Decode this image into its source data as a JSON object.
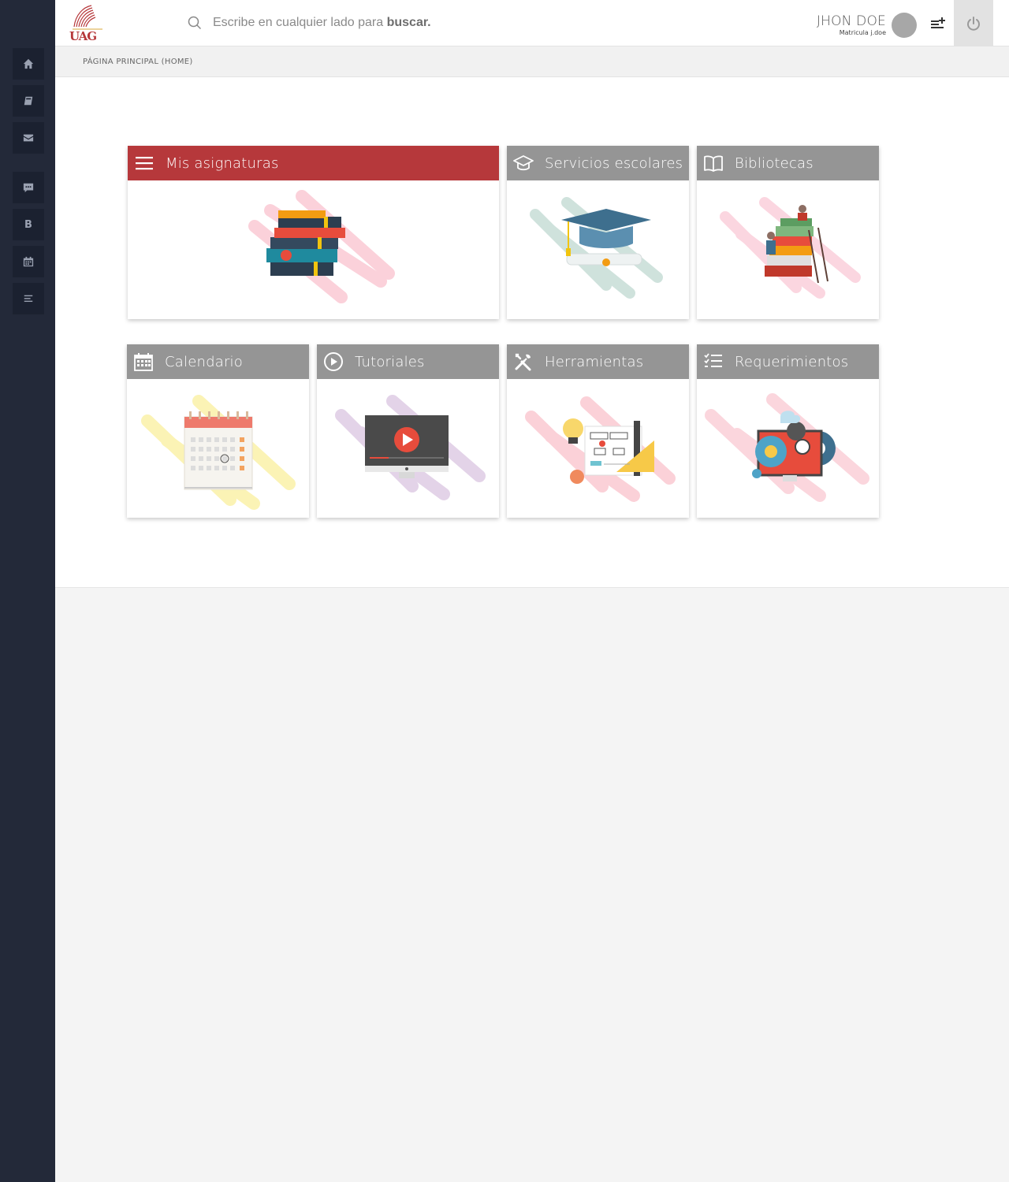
{
  "header": {
    "logo_text": "UAG",
    "search_placeholder": "Escribe en cualquier lado para",
    "search_keyword": "buscar.",
    "user_name": "JHON DOE",
    "user_id": "Matricula j.doe"
  },
  "breadcrumb": "PÁGINA PRINCIPAL (HOME)",
  "sidebar": {
    "items": [
      {
        "icon": "home-icon"
      },
      {
        "icon": "book-icon"
      },
      {
        "icon": "mail-icon"
      },
      {
        "icon": "chat-icon"
      },
      {
        "icon": "letter-b-icon",
        "label": "B"
      },
      {
        "icon": "calendar-icon"
      },
      {
        "icon": "menu-icon"
      }
    ]
  },
  "cards": [
    {
      "title": "Mis asignaturas",
      "icon": "hamburger-icon",
      "color": "#b6383b"
    },
    {
      "title": "Servicios escolares",
      "icon": "graduation-cap-icon",
      "color": "#959595"
    },
    {
      "title": "Bibliotecas",
      "icon": "open-book-icon",
      "color": "#959595"
    },
    {
      "title": "Calendario",
      "icon": "calendar-icon",
      "color": "#959595"
    },
    {
      "title": "Tutoriales",
      "icon": "play-circle-icon",
      "color": "#959595"
    },
    {
      "title": "Herramientas",
      "icon": "tools-icon",
      "color": "#959595"
    },
    {
      "title": "Requerimientos",
      "icon": "checklist-icon",
      "color": "#959595"
    }
  ]
}
